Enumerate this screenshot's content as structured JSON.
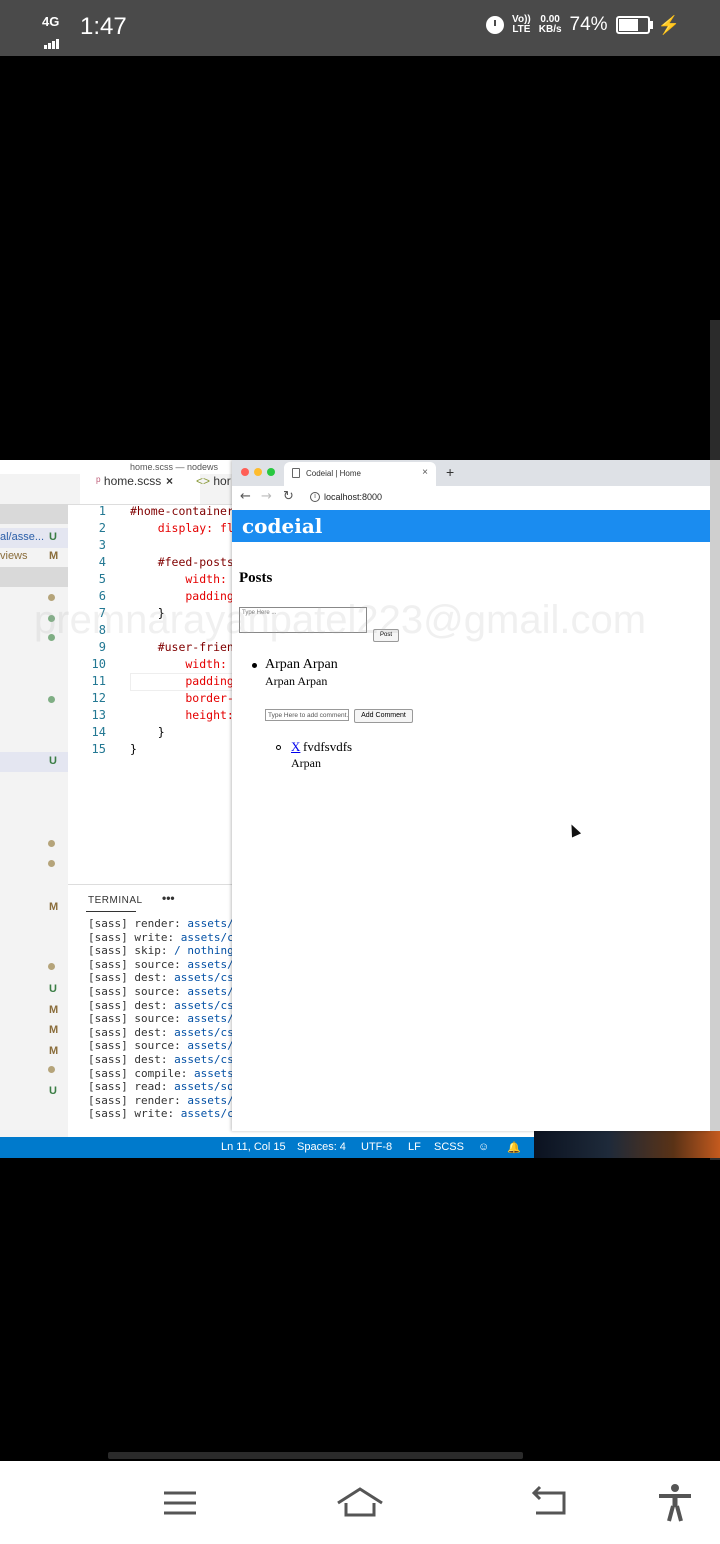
{
  "statusbar": {
    "network": "4G",
    "time": "1:47",
    "volte_top": "Vo))",
    "volte_bottom": "LTE",
    "speed_value": "0.00",
    "speed_unit": "KB/s",
    "battery_percent": "74%",
    "battery_level": 0.74
  },
  "editor": {
    "window_title": "home.scss — nodews",
    "tabs": [
      "home.scss",
      "hor"
    ],
    "explorer": [
      {
        "label": "al/asse...",
        "status": "U"
      },
      {
        "label": "views",
        "status": "M"
      }
    ],
    "explorer_badges": [
      "U",
      "M",
      "U",
      "M",
      "M",
      "M",
      "U"
    ],
    "line_numbers": [
      "1",
      "2",
      "3",
      "4",
      "5",
      "6",
      "7",
      "8",
      "9",
      "10",
      "11",
      "12",
      "13",
      "14",
      "15"
    ],
    "code_lines": [
      "#home-container",
      "    display: fl",
      "",
      "    #feed-posts",
      "        width: ",
      "        padding",
      "    }",
      "",
      "    #user-frien",
      "        width: ",
      "        padding",
      "        border-",
      "        height:",
      "    }",
      "}"
    ],
    "terminal_tab": "TERMINAL",
    "terminal_more": "•••",
    "terminal_lines": [
      {
        "prefix": "[sass]",
        "cmd": "render:",
        "path": "assets/"
      },
      {
        "prefix": "[sass]",
        "cmd": "write:",
        "path": "assets/c"
      },
      {
        "prefix": "[sass]",
        "cmd": "skip:",
        "path": "/ nothing"
      },
      {
        "prefix": "[sass]",
        "cmd": "source:",
        "path": "assets/"
      },
      {
        "prefix": "[sass]",
        "cmd": "dest:",
        "path": "assets/cs"
      },
      {
        "prefix": "[sass]",
        "cmd": "source:",
        "path": "assets/"
      },
      {
        "prefix": "[sass]",
        "cmd": "dest:",
        "path": "assets/cs"
      },
      {
        "prefix": "[sass]",
        "cmd": "source:",
        "path": "assets/"
      },
      {
        "prefix": "[sass]",
        "cmd": "dest:",
        "path": "assets/cs"
      },
      {
        "prefix": "[sass]",
        "cmd": "source:",
        "path": "assets/"
      },
      {
        "prefix": "[sass]",
        "cmd": "dest:",
        "path": "assets/cs"
      },
      {
        "prefix": "[sass]",
        "cmd": "compile:",
        "path": "assets"
      },
      {
        "prefix": "[sass]",
        "cmd": "read:",
        "path": "assets/so"
      },
      {
        "prefix": "[sass]",
        "cmd": "render:",
        "path": "assets/"
      },
      {
        "prefix": "[sass]",
        "cmd": "write:",
        "path": "assets/c"
      }
    ],
    "status": {
      "position": "Ln 11, Col 15",
      "spaces": "Spaces: 4",
      "encoding": "UTF-8",
      "eol": "LF",
      "language": "SCSS"
    }
  },
  "browser": {
    "tab_title": "Codeial | Home",
    "tab_close": "×",
    "new_tab": "+",
    "url": "localhost:8000",
    "brand": "codeial",
    "posts_heading": "Posts",
    "post_placeholder": "Type Here ...",
    "post_button": "Post",
    "post": {
      "content": "Arpan Arpan",
      "author": "Arpan Arpan",
      "comment_placeholder": "Type Here to add comment...",
      "comment_button": "Add Comment",
      "comment": {
        "delete": "X",
        "content": "fvdfsvdfs",
        "author": "Arpan"
      }
    },
    "watermark": "premnarayanpatel223@gmail.com"
  },
  "colors": {
    "statusbar_bg": "#4a4a4a",
    "app_bar": "#1a8cf0",
    "vscode_status": "#007acc"
  }
}
